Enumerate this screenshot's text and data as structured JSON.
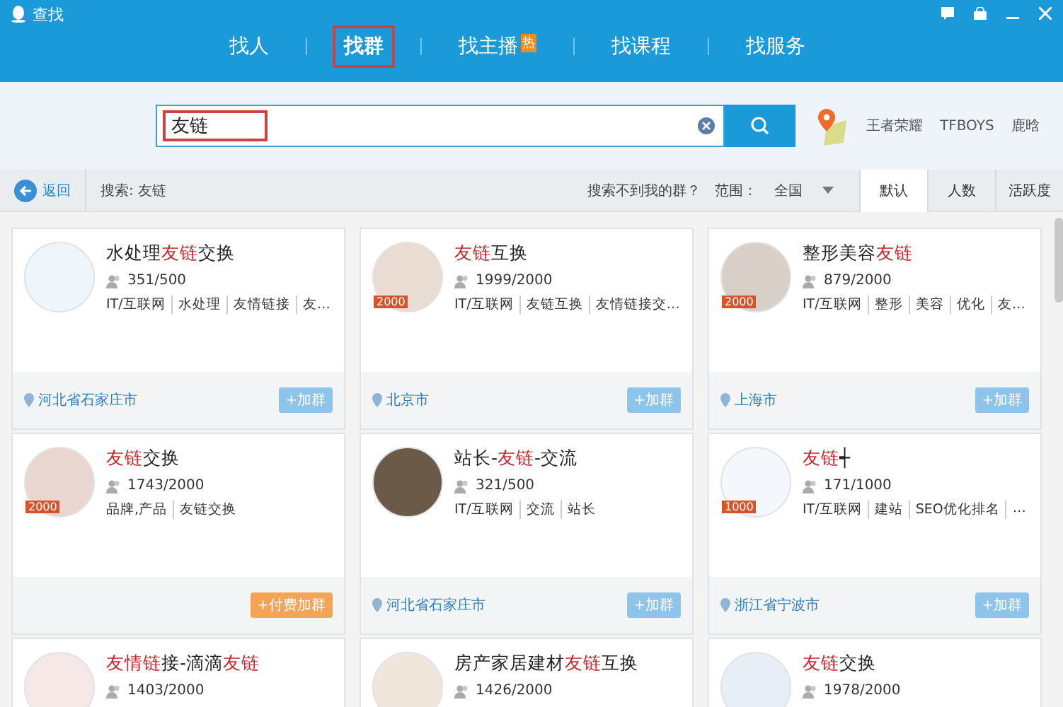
{
  "window": {
    "title": "查找"
  },
  "tabs": [
    {
      "label": "找人",
      "selected": false
    },
    {
      "label": "找群",
      "selected": true
    },
    {
      "label": "找主播",
      "selected": false,
      "badge": "热"
    },
    {
      "label": "找课程",
      "selected": false
    },
    {
      "label": "找服务",
      "selected": false
    }
  ],
  "search": {
    "value": "友链",
    "hot_words": [
      "王者荣耀",
      "TFBOYS",
      "鹿晗"
    ]
  },
  "filter_bar": {
    "back": "返回",
    "query": "搜索: 友链",
    "hint": "搜索不到我的群？",
    "range_label": "范围：",
    "range_value": "全国",
    "sorts": [
      {
        "label": "默认",
        "selected": true
      },
      {
        "label": "人数",
        "selected": false
      },
      {
        "label": "活跃度",
        "selected": false
      }
    ]
  },
  "cards": [
    {
      "name": [
        {
          "text": "水处理",
          "hl": false
        },
        {
          "text": "友链",
          "hl": true
        },
        {
          "text": "交换",
          "hl": false
        }
      ],
      "members": "351/500",
      "tags": [
        "IT/互联网",
        "水处理",
        "友情链接",
        "友…"
      ],
      "location": "河北省石家庄市",
      "button": {
        "label": "+加群",
        "kind": "free"
      }
    },
    {
      "name": [
        {
          "text": "友链",
          "hl": true
        },
        {
          "text": "互换",
          "hl": false
        }
      ],
      "badge": "2000",
      "members": "1999/2000",
      "tags": [
        "IT/互联网",
        "友链互换",
        "友情链接交…"
      ],
      "location": "北京市",
      "button": {
        "label": "+加群",
        "kind": "free"
      }
    },
    {
      "name": [
        {
          "text": "整形美容",
          "hl": false
        },
        {
          "text": "友链",
          "hl": true
        }
      ],
      "badge": "2000",
      "members": "879/2000",
      "tags": [
        "IT/互联网",
        "整形",
        "美容",
        "优化",
        "友…"
      ],
      "location": "上海市",
      "button": {
        "label": "+加群",
        "kind": "free"
      }
    },
    {
      "name": [
        {
          "text": "友链",
          "hl": true
        },
        {
          "text": "交换",
          "hl": false
        }
      ],
      "badge": "2000",
      "members": "1743/2000",
      "tags": [
        "品牌,产品",
        "友链交换"
      ],
      "button": {
        "label": "+付费加群",
        "kind": "paid"
      }
    },
    {
      "name": [
        {
          "text": "站长-",
          "hl": false
        },
        {
          "text": "友链",
          "hl": true
        },
        {
          "text": "-交流",
          "hl": false
        }
      ],
      "members": "321/500",
      "tags": [
        "IT/互联网",
        "交流",
        "站长"
      ],
      "location": "河北省石家庄市",
      "button": {
        "label": "+加群",
        "kind": "free"
      }
    },
    {
      "name": [
        {
          "text": "友链",
          "hl": true
        },
        {
          "text": "┽",
          "hl": false
        }
      ],
      "badge": "1000",
      "members": "171/1000",
      "tags": [
        "IT/互联网",
        "建站",
        "SEO优化排名",
        "…"
      ],
      "location": "浙江省宁波市",
      "button": {
        "label": "+加群",
        "kind": "free"
      }
    },
    {
      "name": [
        {
          "text": "友情",
          "hl": true
        },
        {
          "text": "链",
          "hl": true
        },
        {
          "text": "接-滴滴",
          "hl": false
        },
        {
          "text": "友链",
          "hl": true
        }
      ],
      "members": "1403/2000"
    },
    {
      "name": [
        {
          "text": "房产家居建材",
          "hl": false
        },
        {
          "text": "友链",
          "hl": true
        },
        {
          "text": "互换",
          "hl": false
        }
      ],
      "members": "1426/2000"
    },
    {
      "name": [
        {
          "text": "友链",
          "hl": true
        },
        {
          "text": "交换",
          "hl": false
        }
      ],
      "members": "1978/2000"
    }
  ]
}
